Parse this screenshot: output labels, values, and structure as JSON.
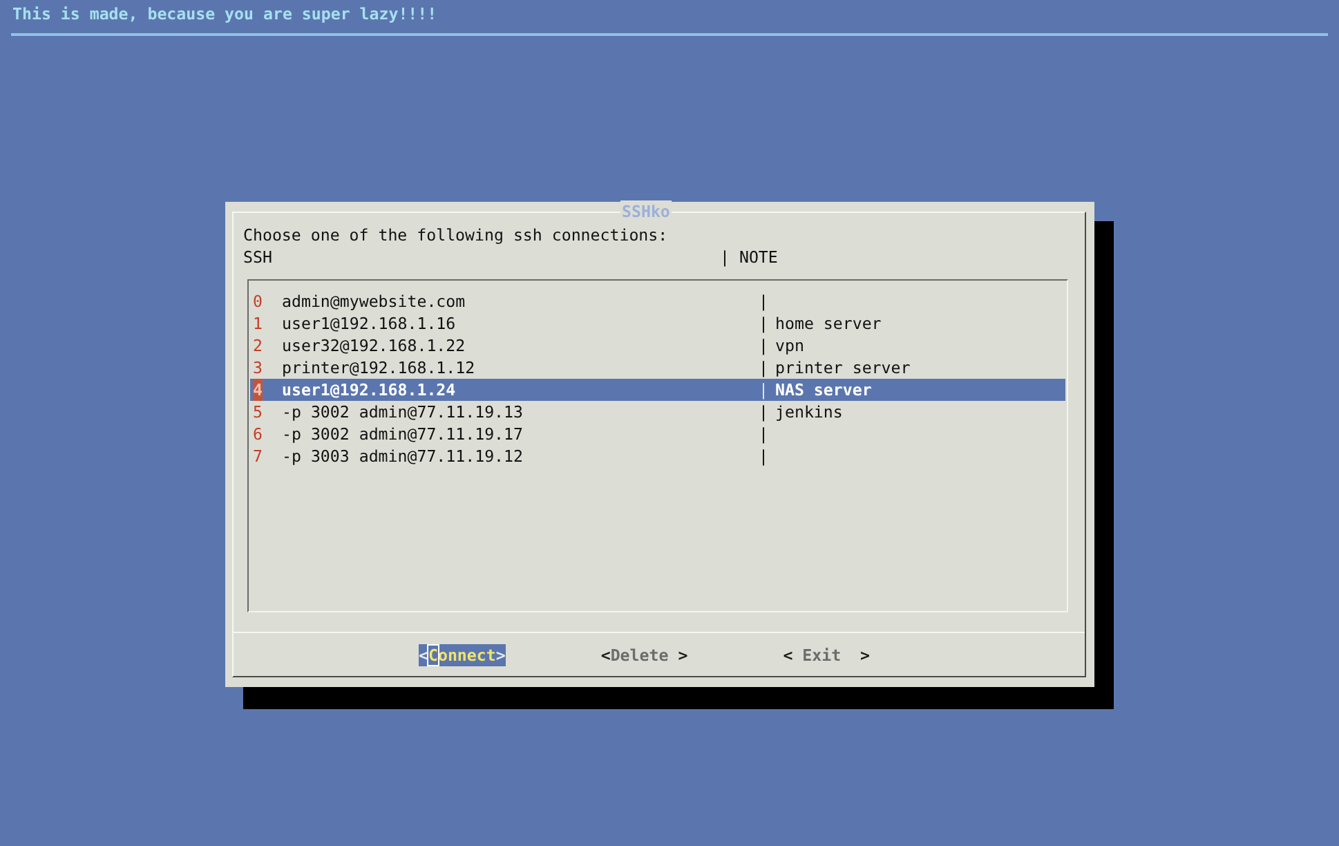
{
  "header": {
    "title": "This is made, because you are super lazy!!!!"
  },
  "dialog": {
    "title": "SSHko",
    "prompt": "Choose one of the following ssh connections:",
    "columns": [
      "SSH",
      "| NOTE"
    ],
    "rows": [
      {
        "index": "0",
        "connection": "admin@mywebsite.com",
        "separator": "|",
        "selected": false
      },
      {
        "index": "1",
        "connection": "user1@192.168.1.16",
        "separator": "|",
        "note": "home server",
        "selected": false
      },
      {
        "index": "2",
        "connection": "user32@192.168.1.22",
        "separator": "|",
        "note": "vpn",
        "selected": false
      },
      {
        "index": "3",
        "connection": "printer@192.168.1.12",
        "separator": "|",
        "note": "printer server",
        "selected": false
      },
      {
        "index": "4",
        "connection": "user1@192.168.1.24",
        "separator": "|",
        "note": "NAS server",
        "selected": true
      },
      {
        "index": "5",
        "connection": "-p 3002 admin@77.11.19.13",
        "separator": "|",
        "note": "jenkins",
        "selected": false
      },
      {
        "index": "6",
        "connection": "-p 3002 admin@77.11.19.17",
        "separator": "|",
        "selected": false
      },
      {
        "index": "7",
        "connection": "-p 3003 admin@77.11.19.12",
        "separator": "|",
        "selected": false
      }
    ],
    "buttons": [
      {
        "label": "<Connect>",
        "selected": true
      },
      {
        "label": "<Delete >",
        "selected": false
      },
      {
        "label": "< Exit  >",
        "selected": false
      }
    ]
  }
}
